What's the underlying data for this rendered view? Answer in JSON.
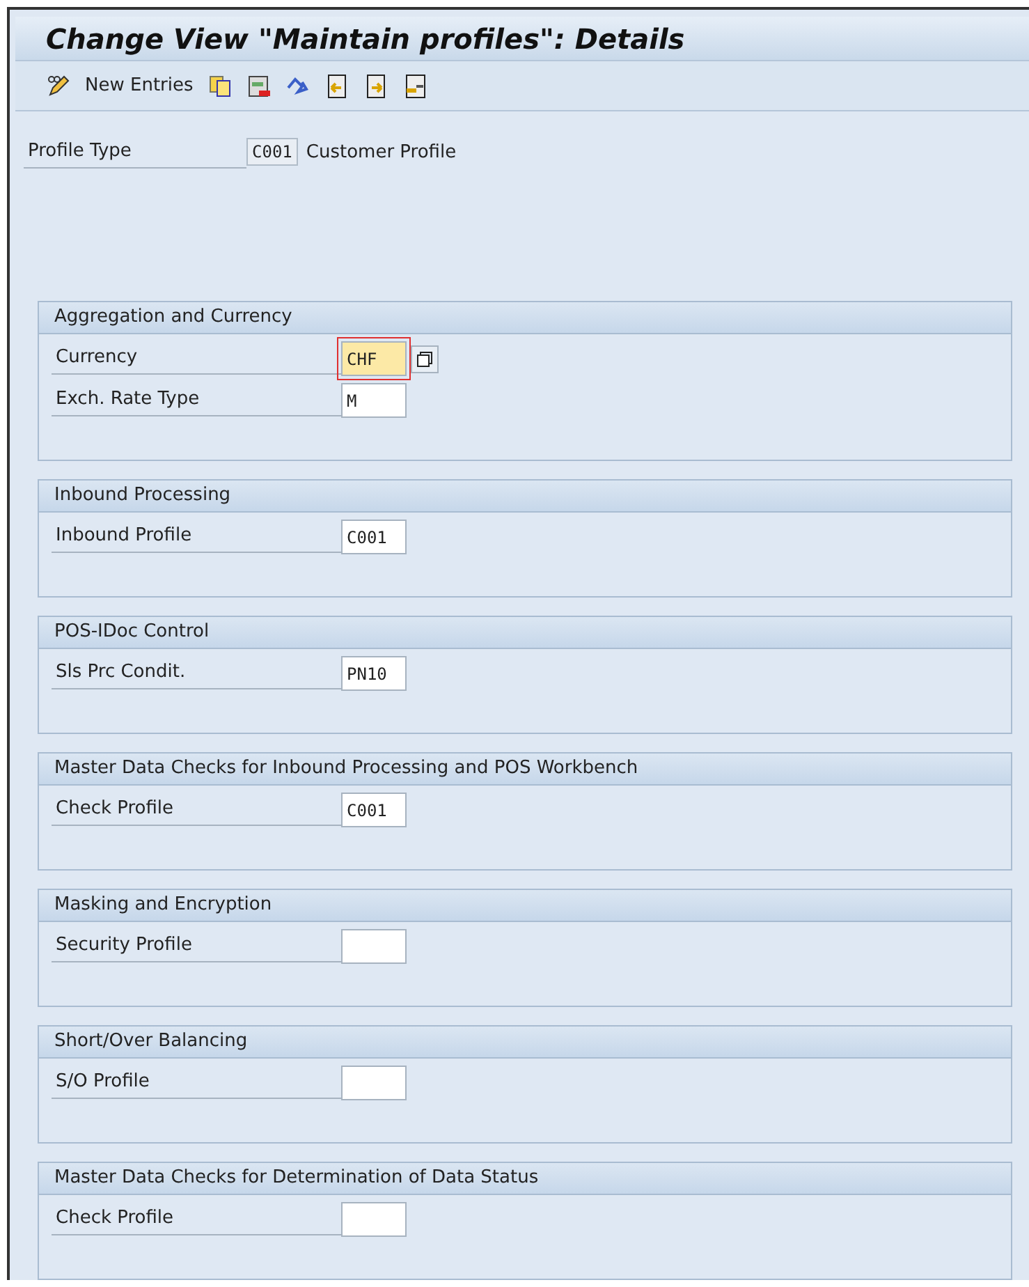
{
  "window": {
    "title": "Change View \"Maintain profiles\": Details"
  },
  "toolbar": {
    "new_entries": "New Entries"
  },
  "profile_type": {
    "label": "Profile Type",
    "value": "C001",
    "description": "Customer Profile"
  },
  "sections": [
    {
      "title": "Aggregation and Currency",
      "fields": [
        {
          "label": "Currency",
          "value": "CHF",
          "focused": true,
          "value_help": true
        },
        {
          "label": "Exch. Rate Type",
          "value": "M",
          "focused": false
        }
      ]
    },
    {
      "title": "Inbound Processing",
      "fields": [
        {
          "label": "Inbound Profile",
          "value": "C001",
          "focused": false
        }
      ]
    },
    {
      "title": "POS-IDoc Control",
      "fields": [
        {
          "label": "Sls Prc Condit.",
          "value": "PN10",
          "focused": false
        }
      ]
    },
    {
      "title": "Master Data Checks for Inbound Processing and POS Workbench",
      "fields": [
        {
          "label": "Check Profile",
          "value": "C001",
          "focused": false
        }
      ]
    },
    {
      "title": "Masking and Encryption",
      "fields": [
        {
          "label": "Security Profile",
          "focused": false
        }
      ]
    },
    {
      "title": "Short/Over Balancing",
      "fields": [
        {
          "label": "S/O Profile",
          "focused": false
        }
      ]
    },
    {
      "title": "Master Data Checks for Determination of Data Status",
      "fields": [
        {
          "label": "Check Profile",
          "focused": false
        }
      ]
    }
  ]
}
